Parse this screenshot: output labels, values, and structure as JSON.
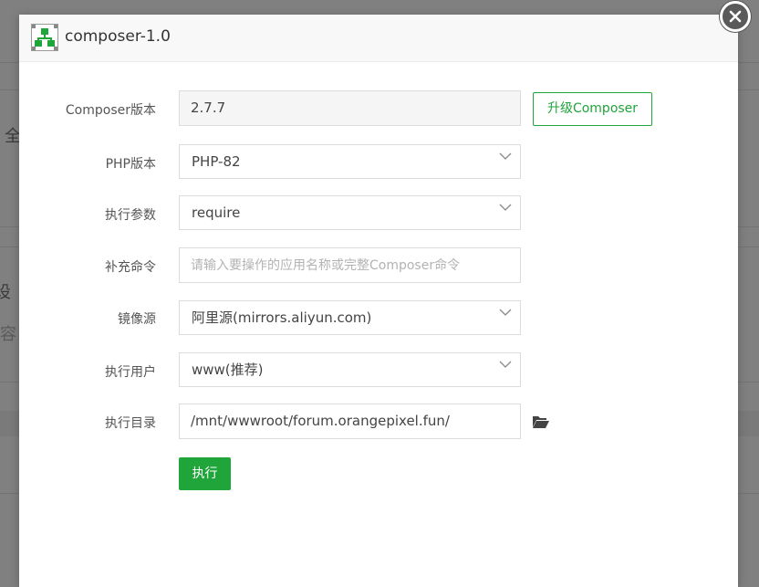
{
  "background": {
    "glyphs": [
      "全",
      "设",
      "容"
    ]
  },
  "dialog": {
    "title": "composer-1.0",
    "icons": {
      "app": "sitemap-icon",
      "close": "close-icon",
      "folder": "folder-open-icon",
      "dropdown": "chevron-down-icon"
    }
  },
  "form": {
    "composer_version": {
      "label": "Composer版本",
      "value": "2.7.7",
      "upgrade_label": "升级Composer"
    },
    "php_version": {
      "label": "PHP版本",
      "value": "PHP-82"
    },
    "exec_params": {
      "label": "执行参数",
      "value": "require"
    },
    "extra_command": {
      "label": "补充命令",
      "value": "",
      "placeholder": "请输入要操作的应用名称或完整Composer命令"
    },
    "mirror": {
      "label": "镜像源",
      "value": "阿里源(mirrors.aliyun.com)"
    },
    "exec_user": {
      "label": "执行用户",
      "value": "www(推荐)"
    },
    "exec_dir": {
      "label": "执行目录",
      "value": "/mnt/wwwroot/forum.orangepixel.fun/"
    },
    "submit_label": "执行"
  },
  "colors": {
    "accent": "#20a53a",
    "overlay": "#808080"
  }
}
